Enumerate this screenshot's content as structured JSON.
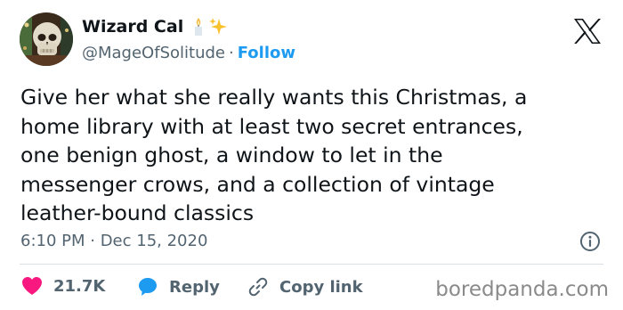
{
  "author": {
    "name": "Wizard Cal",
    "handle": "@MageOfSolitude",
    "separator": "·",
    "follow_label": "Follow",
    "name_emojis": [
      "candle-icon",
      "sparkles-icon"
    ]
  },
  "platform_icon": "x-logo-icon",
  "tweet": {
    "text": "Give her what she really wants this Christmas, a\nhome library with at least two secret entrances,\none benign ghost, a window to let in the\nmessenger crows, and a collection of vintage\nleather-bound classics",
    "timestamp": "6:10 PM · Dec 15, 2020"
  },
  "actions": {
    "like_count": "21.7K",
    "reply_label": "Reply",
    "copy_link_label": "Copy link"
  },
  "watermark": "boredpanda.com",
  "colors": {
    "accent": "#1d9bf0",
    "like": "#f91880",
    "text": "#0f1419",
    "muted": "#536471"
  }
}
